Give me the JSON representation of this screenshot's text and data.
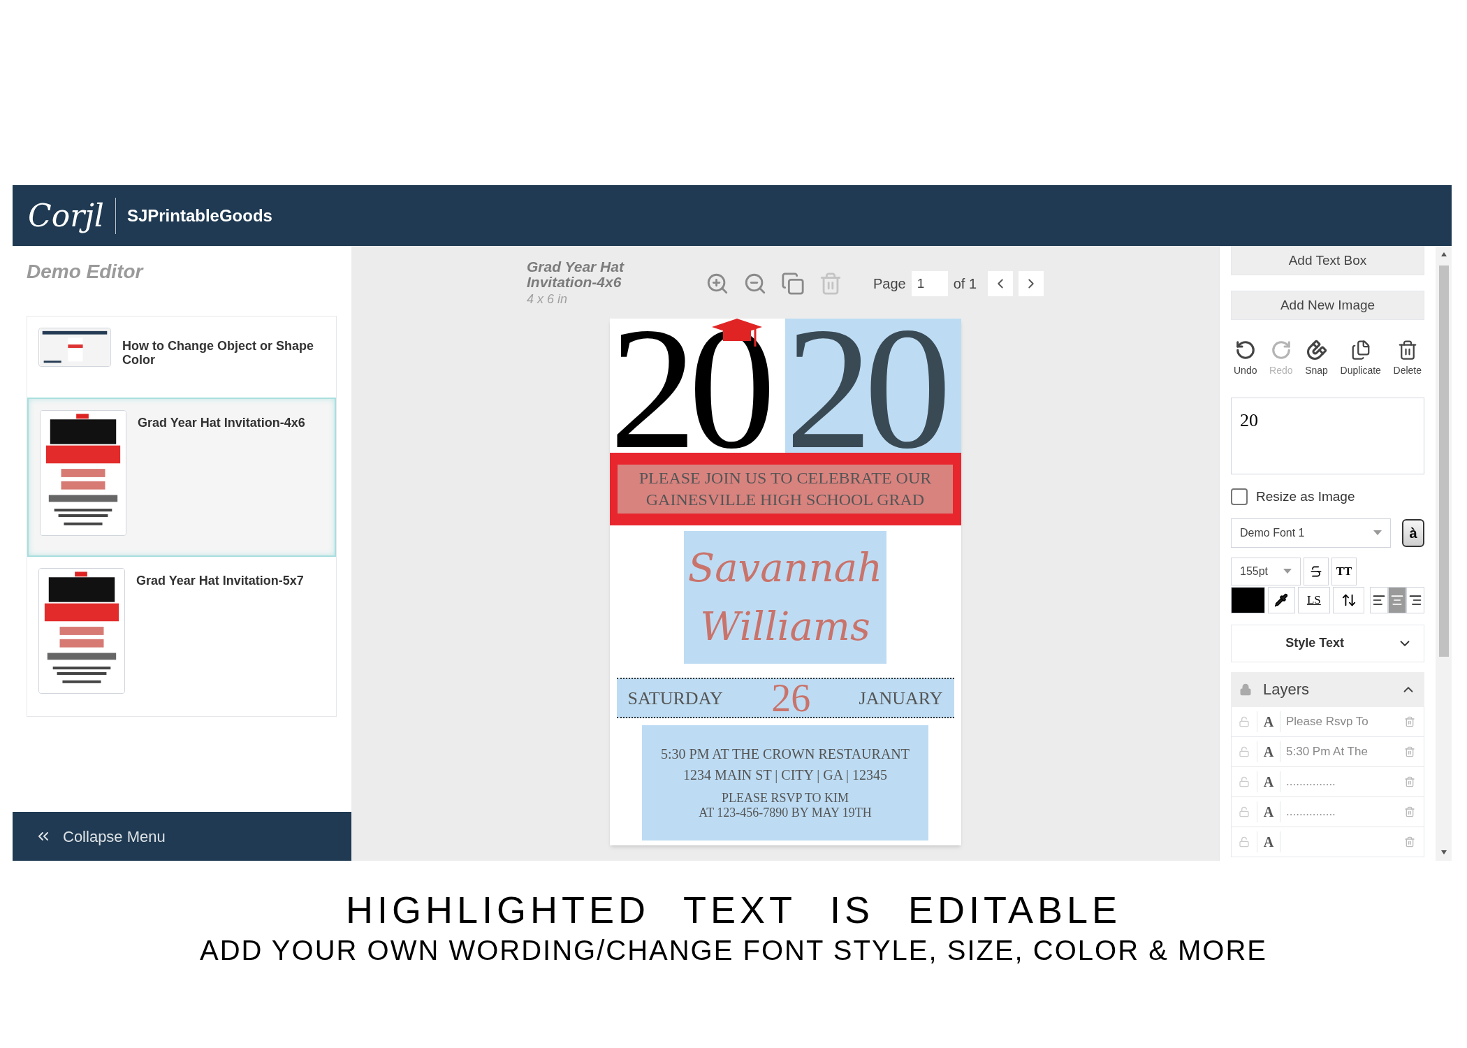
{
  "header": {
    "logo": "Corjl",
    "shop": "SJPrintableGoods"
  },
  "sidebar": {
    "title": "Demo Editor",
    "items": [
      {
        "label": "How to Change Object or Shape Color",
        "kind": "video",
        "selected": false
      },
      {
        "label": "Grad Year Hat Invitation-4x6",
        "kind": "invite",
        "selected": true
      },
      {
        "label": "Grad Year Hat Invitation-5x7",
        "kind": "invite",
        "selected": false
      }
    ],
    "collapse": "Collapse Menu"
  },
  "toolbar": {
    "title": "Grad Year Hat Invitation-4x6",
    "size": "4 x 6 in",
    "delete_disabled": true,
    "page_label": "Page",
    "page": "1",
    "page_of": "of 1"
  },
  "invitation": {
    "year": [
      {
        "text": "20",
        "highlighted": false
      },
      {
        "text": "20",
        "highlighted": true
      }
    ],
    "intro": {
      "lines": [
        "PLEASE JOIN US TO CELEBRATE OUR",
        "GAINESVILLE HIGH SCHOOL GRAD"
      ],
      "highlighted": true
    },
    "name": {
      "lines": [
        "Savannah",
        "Williams"
      ],
      "highlighted": true
    },
    "date": {
      "day": "SATURDAY",
      "number": "26",
      "month": "JANUARY",
      "highlighted": true
    },
    "details": {
      "lines": [
        "5:30 PM AT THE CROWN RESTAURANT",
        "1234 MAIN ST | CITY | GA | 12345"
      ],
      "rsvp": [
        "PLEASE RSVP TO KIM",
        "AT 123-456-7890 BY MAY 19TH"
      ],
      "highlighted": true
    }
  },
  "panel": {
    "add_buttons": [
      "Add Text Box",
      "Add New Image"
    ],
    "tools": [
      {
        "kind": "undo",
        "label": "Undo",
        "disabled": false
      },
      {
        "kind": "redo",
        "label": "Redo",
        "disabled": true
      },
      {
        "kind": "snap",
        "label": "Snap",
        "disabled": false
      },
      {
        "kind": "duplicate",
        "label": "Duplicate",
        "disabled": false
      },
      {
        "kind": "delete",
        "label": "Delete",
        "disabled": false
      }
    ],
    "text_value": "20",
    "resize_as_image": {
      "label": "Resize as Image",
      "checked": false
    },
    "font": "Demo Font 1",
    "font_button": "à",
    "font_size": "155pt",
    "caps_button": "TT",
    "letter_spacing_button": "LS",
    "color": "#000000",
    "align": [
      {
        "kind": "left",
        "selected": false
      },
      {
        "kind": "center",
        "selected": true
      },
      {
        "kind": "right",
        "selected": false
      }
    ],
    "style_text": {
      "label": "Style Text",
      "expanded": false
    },
    "layers": {
      "title": "Layers",
      "expanded": true,
      "rows": [
        {
          "glyph": "A",
          "name": "Please Rsvp To",
          "locked": false
        },
        {
          "glyph": "A",
          "name": "5:30 Pm At The",
          "locked": false
        },
        {
          "glyph": "A",
          "name": "...............",
          "locked": false
        },
        {
          "glyph": "A",
          "name": "...............",
          "locked": false
        },
        {
          "glyph": "A",
          "locked": false
        }
      ]
    }
  },
  "caption": {
    "title": "HIGHLIGHTED TEXT IS EDITABLE",
    "subtitle": "ADD YOUR OWN WORDING/CHANGE FONT STYLE, SIZE, COLOR & MORE"
  }
}
